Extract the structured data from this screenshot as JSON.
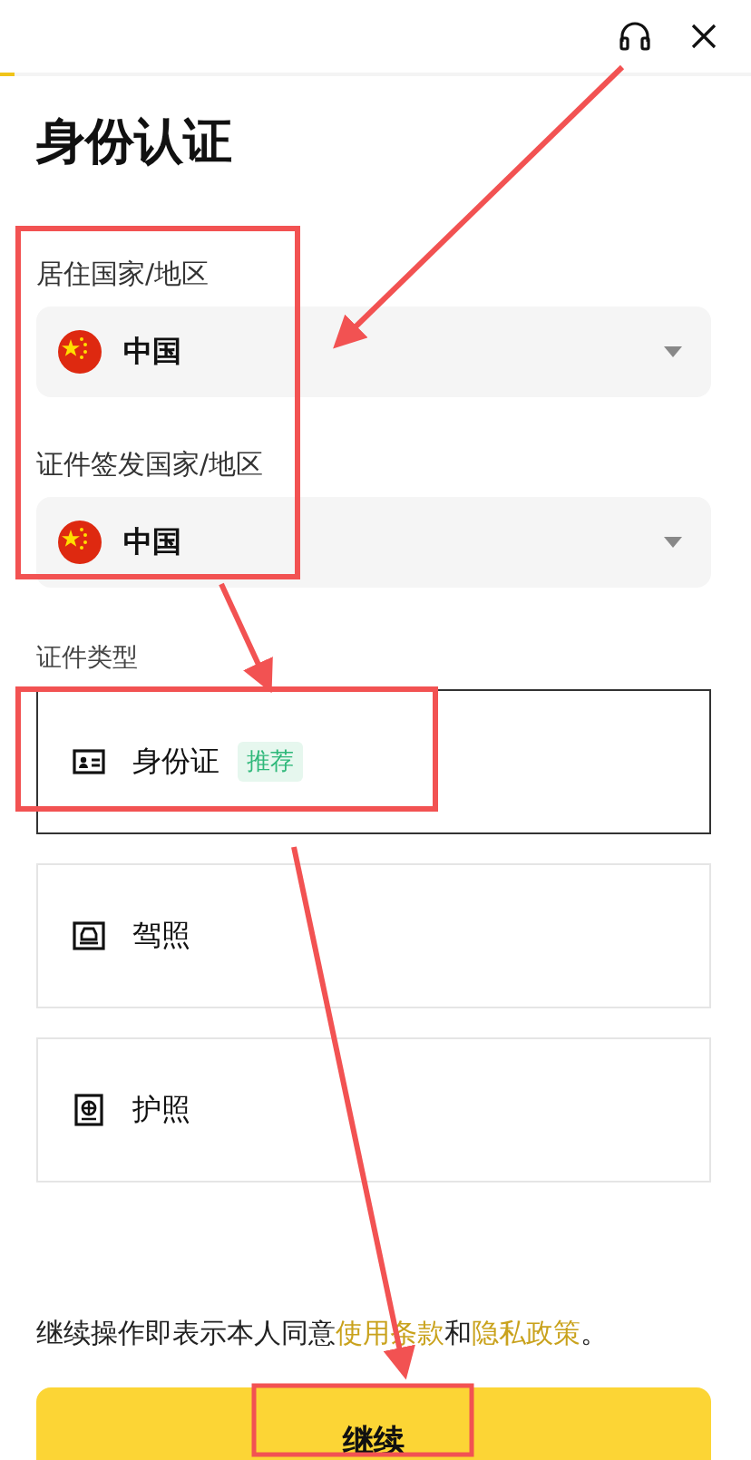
{
  "progress": {
    "level": 0.02
  },
  "title": "身份认证",
  "fields": [
    {
      "label": "居住国家/地区",
      "value": "中国"
    },
    {
      "label": "证件签发国家/地区",
      "value": "中国"
    }
  ],
  "doc_type": {
    "label": "证件类型",
    "options": [
      {
        "kind": "id_card",
        "label": "身份证",
        "badge": "推荐",
        "selected": true
      },
      {
        "kind": "license",
        "label": "驾照",
        "selected": false
      },
      {
        "kind": "passport",
        "label": "护照",
        "selected": false
      }
    ]
  },
  "terms": [
    {
      "kind": "text",
      "text": "继续操作即表示本人同意"
    },
    {
      "kind": "link",
      "text": "使用条款"
    },
    {
      "kind": "text",
      "text": "和"
    },
    {
      "kind": "link",
      "text": "隐私政策"
    },
    {
      "kind": "text",
      "text": "。"
    }
  ],
  "continue_button": "继续"
}
